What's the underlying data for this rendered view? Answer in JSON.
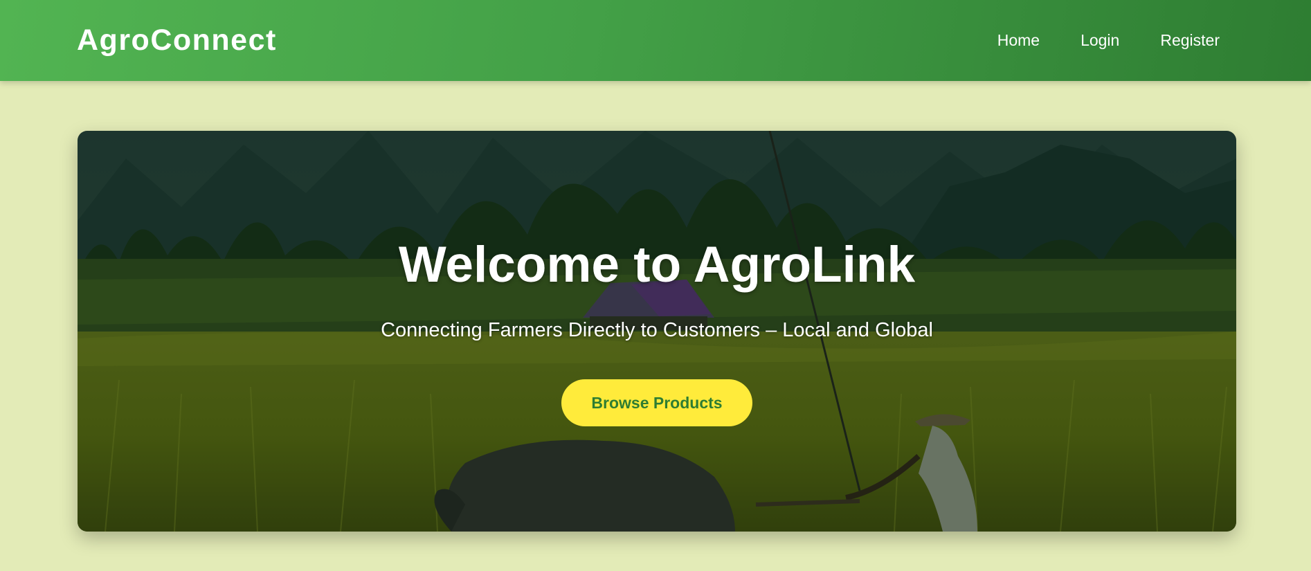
{
  "header": {
    "brand": "AgroConnect",
    "nav": [
      {
        "label": "Home"
      },
      {
        "label": "Login"
      },
      {
        "label": "Register"
      }
    ]
  },
  "hero": {
    "title": "Welcome to AgroLink",
    "subtitle": "Connecting Farmers Directly to Customers – Local and Global",
    "cta_label": "Browse Products"
  },
  "colors": {
    "page_background": "#e3ebb7",
    "header_start": "#52b452",
    "header_end": "#2e7d32",
    "cta_background": "#ffeb3b",
    "cta_text": "#2e7d32"
  }
}
